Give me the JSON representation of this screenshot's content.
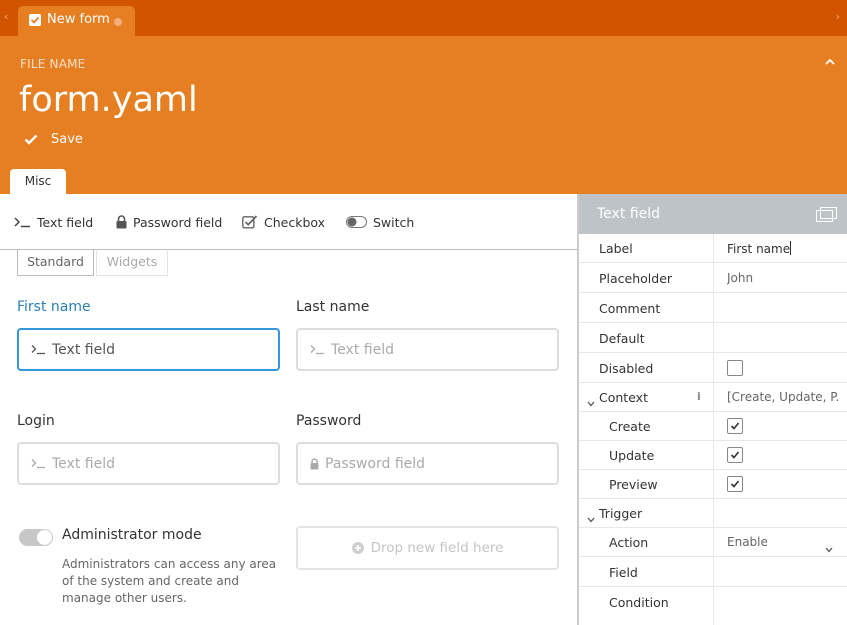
{
  "tabs": {
    "open_tab": "New form"
  },
  "header": {
    "file_name_label": "FILE NAME",
    "file_name": "form.yaml",
    "save_label": "Save",
    "section_tab": "Misc"
  },
  "toolbar": {
    "items": [
      {
        "label": "Text field",
        "icon": "terminal-icon"
      },
      {
        "label": "Password field",
        "icon": "lock-icon"
      },
      {
        "label": "Checkbox",
        "icon": "checkbox-icon"
      },
      {
        "label": "Switch",
        "icon": "switch-icon"
      }
    ]
  },
  "subtabs": {
    "standard": "Standard",
    "widgets": "Widgets"
  },
  "form": {
    "first_name": {
      "label": "First name",
      "placeholder": "Text field"
    },
    "last_name": {
      "label": "Last name",
      "placeholder": "Text field"
    },
    "login": {
      "label": "Login",
      "placeholder": "Text field"
    },
    "password": {
      "label": "Password",
      "placeholder": "Password field"
    },
    "admin": {
      "title": "Administrator mode",
      "description": "Administrators can access any area of the system and create and manage other users."
    },
    "dropzone": "Drop new field here"
  },
  "inspector": {
    "title": "Text field",
    "properties": {
      "label": {
        "key": "Label",
        "value": "First name"
      },
      "placeholder": {
        "key": "Placeholder",
        "value": "John"
      },
      "comment": {
        "key": "Comment",
        "value": ""
      },
      "default": {
        "key": "Default",
        "value": ""
      },
      "disabled": {
        "key": "Disabled",
        "checked": false
      },
      "context": {
        "key": "Context",
        "value": "[Create, Update, P..."
      },
      "create": {
        "key": "Create",
        "checked": true
      },
      "update": {
        "key": "Update",
        "checked": true
      },
      "preview": {
        "key": "Preview",
        "checked": true
      },
      "trigger": {
        "key": "Trigger"
      },
      "action": {
        "key": "Action",
        "value": "Enable"
      },
      "field": {
        "key": "Field",
        "value": ""
      },
      "condition": {
        "key": "Condition",
        "value": ""
      }
    }
  },
  "colors": {
    "tab_strip": "#d35400",
    "header": "#e67e22",
    "focus": "#3498db",
    "inspector_header": "#bdc3c7"
  }
}
